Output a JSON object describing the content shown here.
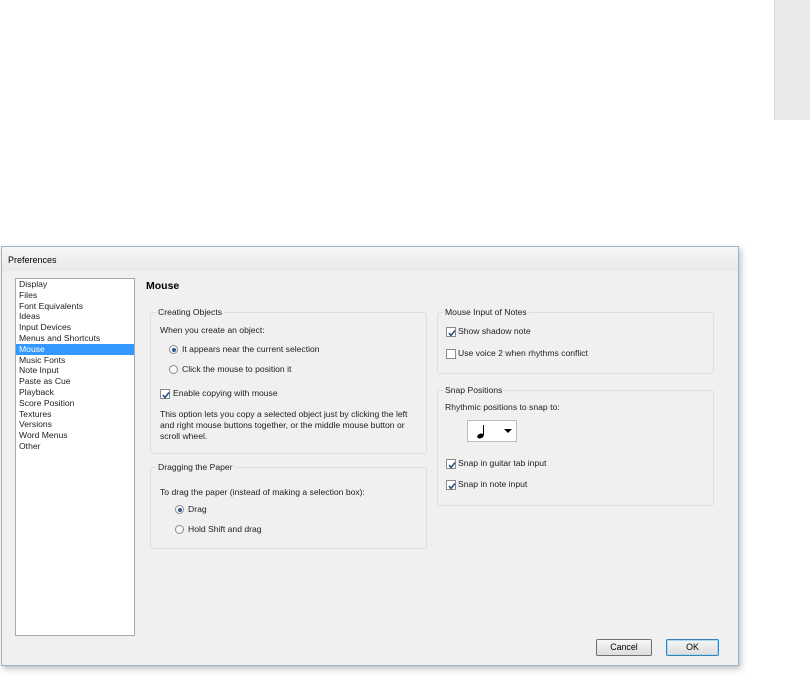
{
  "window": {
    "title": "Preferences"
  },
  "categories": [
    "Display",
    "Files",
    "Font Equivalents",
    "Ideas",
    "Input Devices",
    "Menus and Shortcuts",
    "Mouse",
    "Music Fonts",
    "Note Input",
    "Paste as Cue",
    "Playback",
    "Score Position",
    "Textures",
    "Versions",
    "Word Menus",
    "Other"
  ],
  "selected_category": "Mouse",
  "page": {
    "heading": "Mouse"
  },
  "creating_objects": {
    "title": "Creating Objects",
    "prompt": "When you create an object:",
    "option_near": "It appears near the current selection",
    "option_click": "Click the mouse to position it",
    "selected_option": "It appears near the current selection",
    "enable_copying_label": "Enable copying with mouse",
    "enable_copying_checked": true,
    "description": "This option lets you copy a selected object just by clicking the left and right mouse buttons together, or the middle mouse button or scroll wheel."
  },
  "dragging_paper": {
    "title": "Dragging the Paper",
    "prompt": "To drag the paper (instead of making a selection box):",
    "option_drag": "Drag",
    "option_shift": "Hold Shift and drag",
    "selected_option": "Drag"
  },
  "mouse_input": {
    "title": "Mouse Input of Notes",
    "show_shadow_label": "Show shadow note",
    "show_shadow_checked": true,
    "use_voice2_label": "Use voice 2 when rhythms conflict",
    "use_voice2_checked": false
  },
  "snap_positions": {
    "title": "Snap Positions",
    "prompt": "Rhythmic positions to snap to:",
    "rhythm_value_icon": "quarter-note-icon",
    "snap_guitar_label": "Snap in guitar tab input",
    "snap_guitar_checked": true,
    "snap_note_label": "Snap in note input",
    "snap_note_checked": true
  },
  "buttons": {
    "cancel": "Cancel",
    "ok": "OK"
  },
  "colors": {
    "selection": "#3399ff",
    "dialog_bg": "#f0f0f0"
  }
}
